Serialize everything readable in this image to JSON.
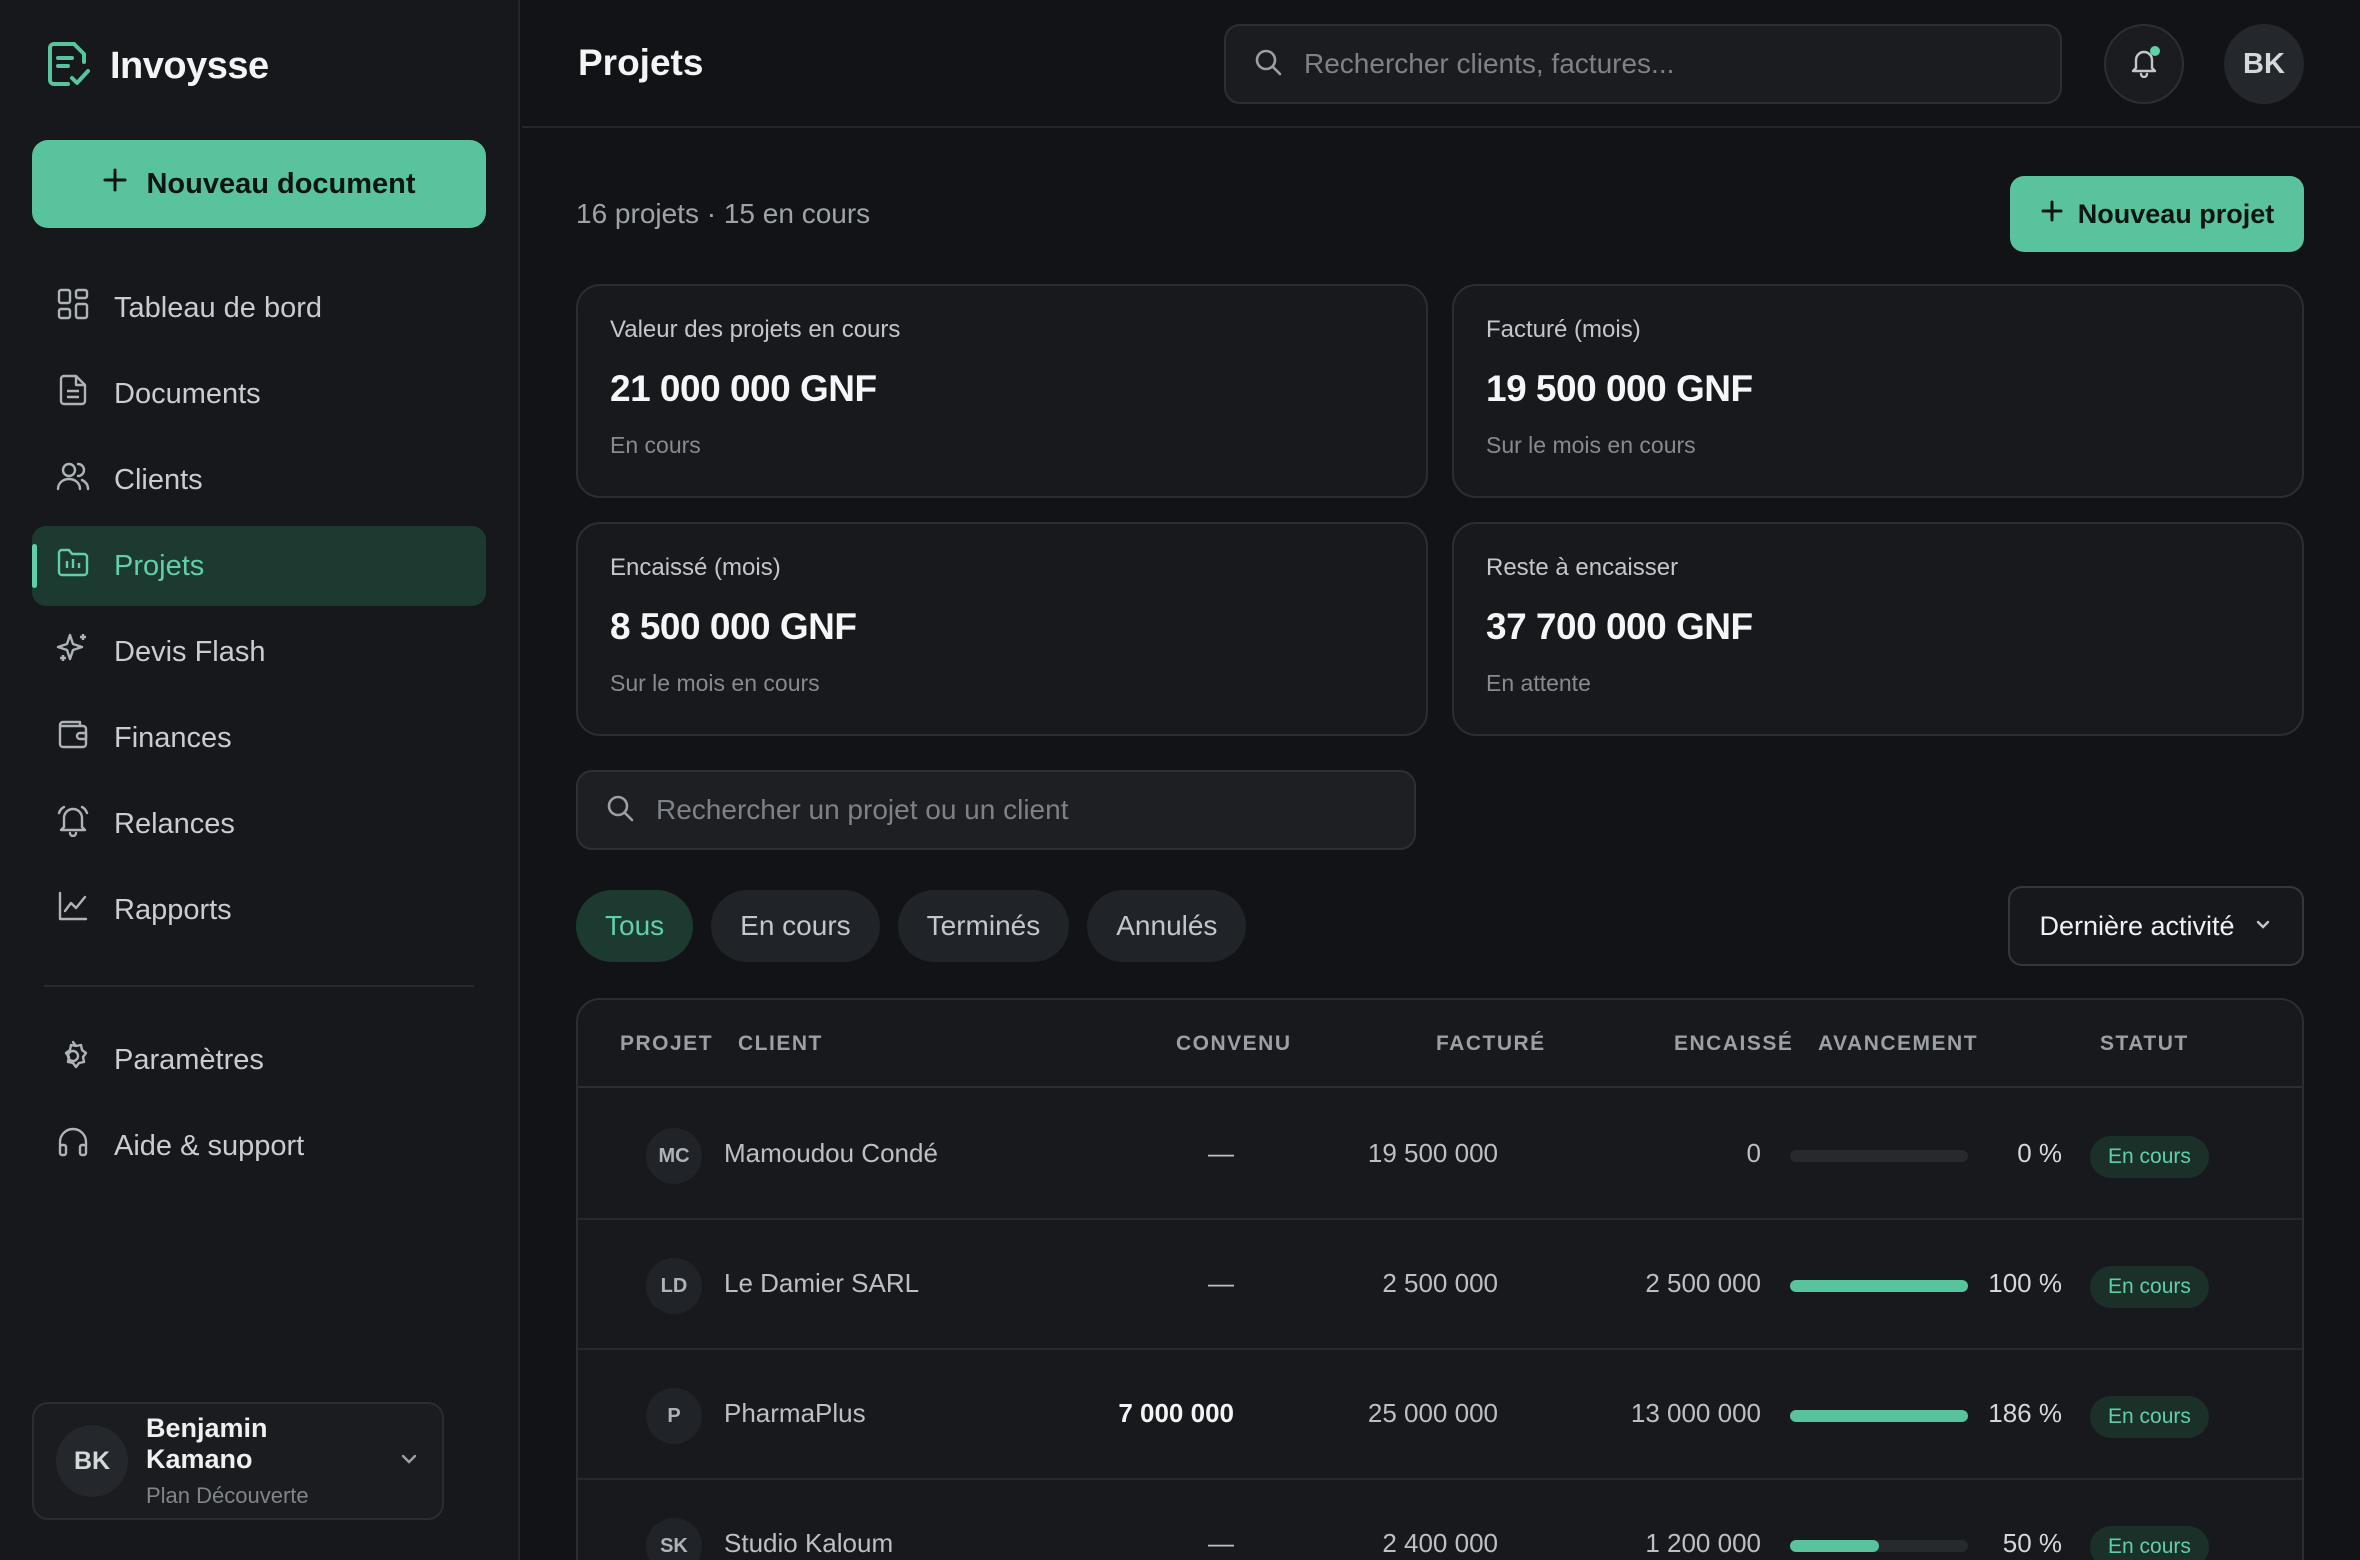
{
  "app": {
    "name": "Invoysse"
  },
  "sidebar": {
    "new_doc_label": "Nouveau document",
    "items": [
      {
        "label": "Tableau de bord",
        "icon": "dashboard-icon"
      },
      {
        "label": "Documents",
        "icon": "document-icon"
      },
      {
        "label": "Clients",
        "icon": "users-icon"
      },
      {
        "label": "Projets",
        "icon": "folder-icon",
        "active": true
      },
      {
        "label": "Devis Flash",
        "icon": "sparkle-icon"
      },
      {
        "label": "Finances",
        "icon": "wallet-icon"
      },
      {
        "label": "Relances",
        "icon": "bell-icon"
      },
      {
        "label": "Rapports",
        "icon": "chart-icon"
      }
    ],
    "secondary": [
      {
        "label": "Paramètres",
        "icon": "gear-icon"
      },
      {
        "label": "Aide & support",
        "icon": "headset-icon"
      }
    ],
    "user": {
      "initials": "BK",
      "name": "Benjamin Kamano",
      "plan": "Plan Découverte"
    }
  },
  "header": {
    "title": "Projets",
    "search_placeholder": "Rechercher clients, factures...",
    "avatar_initials": "BK"
  },
  "main": {
    "subtitle": "16 projets · 15 en cours",
    "new_project_label": "Nouveau projet",
    "stats": [
      {
        "label": "Valeur des projets en cours",
        "value": "21 000 000 GNF",
        "sub": "En cours"
      },
      {
        "label": "Facturé (mois)",
        "value": "19 500 000 GNF",
        "sub": "Sur le mois en cours"
      },
      {
        "label": "Encaissé (mois)",
        "value": "8 500 000 GNF",
        "sub": "Sur le mois en cours"
      },
      {
        "label": "Reste à encaisser",
        "value": "37 700 000 GNF",
        "sub": "En attente"
      }
    ],
    "project_search_placeholder": "Rechercher un projet ou un client",
    "filters": [
      {
        "label": "Tous",
        "active": true
      },
      {
        "label": "En cours"
      },
      {
        "label": "Terminés"
      },
      {
        "label": "Annulés"
      }
    ],
    "sort_label": "Dernière activité"
  },
  "table": {
    "headers": {
      "projet": "PROJET",
      "client": "CLIENT",
      "convenu": "CONVENU",
      "facture": "FACTURÉ",
      "encaisse": "ENCAISSÉ",
      "avancement": "AVANCEMENT",
      "statut": "STATUT"
    },
    "rows": [
      {
        "initials": "MC",
        "client": "Mamoudou Condé",
        "convenu": "—",
        "facture": "19 500 000",
        "encaisse": "0",
        "progress": 0,
        "progress_label": "0 %",
        "status": "En cours"
      },
      {
        "initials": "LD",
        "client": "Le Damier SARL",
        "convenu": "—",
        "facture": "2 500 000",
        "encaisse": "2 500 000",
        "progress": 100,
        "progress_label": "100 %",
        "status": "En cours"
      },
      {
        "initials": "P",
        "client": "PharmaPlus",
        "convenu": "7 000 000",
        "facture": "25 000 000",
        "encaisse": "13 000 000",
        "progress": 100,
        "progress_label": "186 %",
        "status": "En cours"
      },
      {
        "initials": "SK",
        "client": "Studio Kaloum",
        "convenu": "—",
        "facture": "2 400 000",
        "encaisse": "1 200 000",
        "progress": 50,
        "progress_label": "50 %",
        "status": "En cours"
      }
    ]
  },
  "colors": {
    "accent": "#58c39c",
    "accent_text": "#5fd0a7",
    "background": "#111316",
    "surface": "#17191c"
  }
}
